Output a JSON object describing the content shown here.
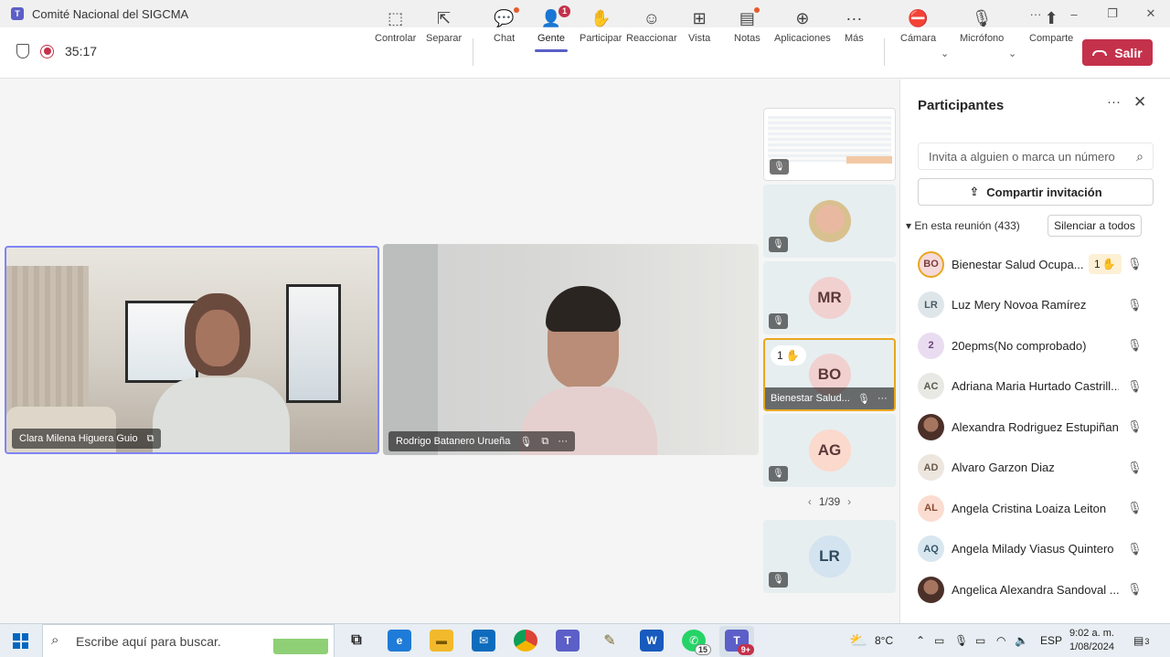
{
  "window": {
    "title": "Comité Nacional del SIGCMA",
    "controls": [
      "···",
      "–",
      "❐",
      "✕"
    ]
  },
  "toolbar": {
    "timer": "35:17",
    "buttons": [
      {
        "label": "Controlar",
        "icon": "control-icon"
      },
      {
        "label": "Separar",
        "icon": "popout-icon"
      },
      {
        "label": "Chat",
        "icon": "chat-icon"
      },
      {
        "label": "Gente",
        "icon": "people-icon",
        "badge": "1"
      },
      {
        "label": "Participar",
        "icon": "raise-hand-icon"
      },
      {
        "label": "Reaccionar",
        "icon": "react-icon"
      },
      {
        "label": "Vista",
        "icon": "view-icon"
      },
      {
        "label": "Notas",
        "icon": "notes-icon"
      },
      {
        "label": "Aplicaciones",
        "icon": "apps-icon"
      },
      {
        "label": "Más",
        "icon": "more-icon"
      },
      {
        "label": "Cámara",
        "icon": "camera-off-icon"
      },
      {
        "label": "Micrófono",
        "icon": "mic-off-icon"
      },
      {
        "label": "Comparte",
        "icon": "share-icon"
      }
    ],
    "leave_label": "Salir"
  },
  "stage": {
    "videos": [
      {
        "name": "Clara Milena Higuera Guio"
      },
      {
        "name": "Rodrigo Batanero Urueña"
      }
    ],
    "strip": {
      "tiles": [
        {
          "initials": ""
        },
        {
          "initials": ""
        },
        {
          "initials": "MR"
        },
        {
          "initials": "BO",
          "label": "Bienestar Salud...",
          "hand": "1"
        },
        {
          "initials": "AG"
        },
        {
          "initials": "LR"
        }
      ],
      "pager": "1/39"
    }
  },
  "panel": {
    "title": "Participantes",
    "search_placeholder": "Invita a alguien o marca un número",
    "share_label": "Compartir invitación",
    "section_label": "En esta reunión (433)",
    "mute_all_label": "Silenciar a todos",
    "participants": [
      {
        "initials": "BO",
        "name": "Bienestar Salud Ocupa...",
        "hand": "1"
      },
      {
        "initials": "LR",
        "name": "Luz Mery Novoa Ramírez"
      },
      {
        "initials": "2",
        "name": "20epms(No comprobado)"
      },
      {
        "initials": "AC",
        "name": "Adriana Maria Hurtado Castrill..."
      },
      {
        "initials": "",
        "name": "Alexandra Rodriguez Estupiñan"
      },
      {
        "initials": "AD",
        "name": "Alvaro Garzon Diaz"
      },
      {
        "initials": "AL",
        "name": "Angela Cristina Loaiza Leiton"
      },
      {
        "initials": "AQ",
        "name": "Angela Milady Viasus Quintero"
      },
      {
        "initials": "",
        "name": "Angelica Alexandra Sandoval ..."
      }
    ]
  },
  "taskbar": {
    "search_placeholder": "Escribe aquí para buscar.",
    "whatsapp_count": "15",
    "teams_count": "9+",
    "weather": "8°C",
    "language": "ESP",
    "time": "9:02 a. m.",
    "date": "1/08/2024",
    "notifications": "3"
  }
}
